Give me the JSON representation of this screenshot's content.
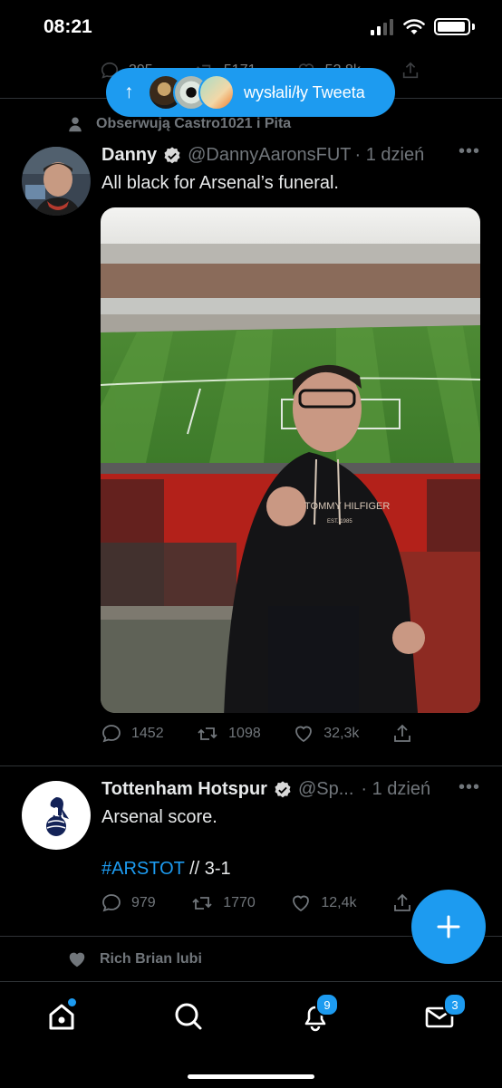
{
  "status_bar": {
    "time": "08:21"
  },
  "new_tweets_pill": {
    "label": "wysłali/ły Tweeta",
    "arrow": "↑"
  },
  "previous_tweet": {
    "reply_count": "395",
    "retweet_count": "5171",
    "like_count": "53,8k"
  },
  "tweet1": {
    "social_context": "Obserwują Castro1021 i Pita",
    "name": "Danny",
    "handle": "@DannyAaronsFUT",
    "time": "· 1 dzień",
    "text": "All black for Arsenal’s funeral.",
    "media_text": {
      "shirt_brand": "TOMMY HILFIGER",
      "shirt_sub": "EST. 1985"
    },
    "replies": "1452",
    "retweets": "1098",
    "likes": "32,3k"
  },
  "tweet2": {
    "name": "Tottenham Hotspur",
    "handle": "@Sp...",
    "time": "· 1 dzień",
    "text_line1": "Arsenal score.",
    "hashtag": "#ARSTOT",
    "text_rest": " // 3-1",
    "replies": "979",
    "retweets": "1770",
    "likes": "12,4k"
  },
  "tweet3": {
    "social_context": "Rich Brian lubi"
  },
  "bottom_nav": {
    "notifications_badge": "9",
    "messages_badge": "3"
  },
  "colors": {
    "accent": "#1d9bf0",
    "background": "#000000",
    "muted": "#71767b",
    "text": "#e7e9ea"
  }
}
